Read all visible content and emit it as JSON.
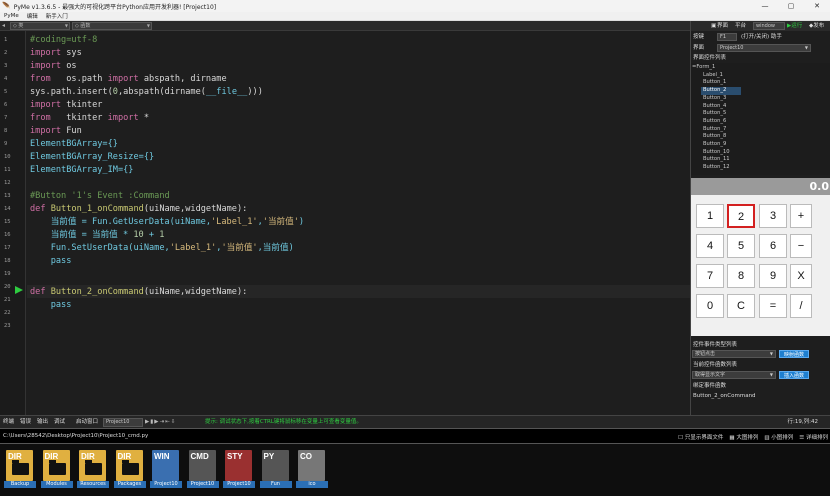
{
  "window": {
    "title": "PyMe v1.3.6.5 - 最强大的可视化跨平台Python应用开发利器! [Project10]",
    "controls": [
      "—",
      "▢",
      "✕"
    ]
  },
  "menu": [
    "PyMe",
    "编辑",
    "新手入门"
  ],
  "toolbar": {
    "class_combo": "◇ 类",
    "func_combo": "◇ 函数"
  },
  "lines": [
    "1",
    "2",
    "3",
    "4",
    "5",
    "6",
    "7",
    "8",
    "9",
    "10",
    "11",
    "12",
    "13",
    "14",
    "15",
    "16",
    "17",
    "18",
    "19",
    "20",
    "21",
    "22",
    "23"
  ],
  "code": {
    "l1": "#coding=utf-8",
    "l2a": "import",
    "l2b": " sys",
    "l3a": "import",
    "l3b": " os",
    "l4a": "from",
    "l4b": "   os.path ",
    "l4c": "import",
    "l4d": " abspath, dirname",
    "l5a": "sys.path.insert(",
    "l5b": "0",
    "l5c": ",abspath(dirname(",
    "l5d": "__file__",
    "l5e": ")))",
    "l6a": "import",
    "l6b": " tkinter",
    "l7a": "from",
    "l7b": "   tkinter ",
    "l7c": "import",
    "l7d": " *",
    "l8a": "import",
    "l8b": " Fun",
    "l9": "ElementBGArray={}",
    "l10": "ElementBGArray_Resize={}",
    "l11": "ElementBGArray_IM={}",
    "l13": "#Button '1's Event :Command",
    "l14a": "def ",
    "l14b": "Button_1_onCommand",
    "l14c": "(uiName,widgetName):",
    "l15a": "    当前值 = Fun.GetUserData(uiName,",
    "l15b": "'Label_1'",
    ",": "",
    "l15c": ",",
    "l15d": "'当前值'",
    "l15e": ")",
    "l16a": "    当前值 = 当前值 * ",
    "l16b": "10",
    "l16c": " + ",
    "l16d": "1",
    "l17a": "    Fun.SetUserData(uiName,",
    "l17b": "'Label_1'",
    "l17c": ",",
    "l17d": "'当前值'",
    "l17e": ",当前值)",
    "l18": "    pass",
    "l20a": "def ",
    "l20b": "Button_2_onCommand",
    "l20c": "(uiName,widgetName):",
    "l21": "    pass"
  },
  "right_panel": {
    "top_tabs": [
      "界面",
      "平台",
      "window",
      "▶运行",
      "◆发布"
    ],
    "hotkey_label": "按键",
    "hotkey_value": "F1",
    "hotkey_desc": "(打开/关闭) 助手",
    "ui_label": "界面",
    "ui_value": "Project10",
    "tree_title": "界面控件列表",
    "tree_root": "=Form_1",
    "tree_items": [
      "Label_1",
      "Button_1",
      "Button_2",
      "Button_3",
      "Button_4",
      "Button_5",
      "Button_6",
      "Button_7",
      "Button_8",
      "Button_9",
      "Button_10",
      "Button_11",
      "Button_12"
    ],
    "selected_index": 2,
    "calc_display": "0.0",
    "calc_keys": [
      "1",
      "2",
      "3",
      "+",
      "4",
      "5",
      "6",
      "−",
      "7",
      "8",
      "9",
      "X",
      "0",
      "C",
      "=",
      "/"
    ],
    "event_title": "控件事件类型列表",
    "event_value": "按钮点击",
    "event_btn": "映射函数",
    "func_title": "当前控件函数列表",
    "func_value": "取得显示文字",
    "func_btn": "插入函数",
    "bind_title": "绑定事件函数",
    "bind_value": "Button_2_onCommand"
  },
  "statusbar": {
    "tabs": [
      "终端",
      "错误",
      "输出",
      "调试"
    ],
    "start_label": "启动窗口",
    "start_value": "Project10",
    "hint": "提示: 调试状态下,按着CTRL键将鼠标移在变量上可查看变量值。",
    "position": "行:19,列:42"
  },
  "terminal": {
    "path": "C:\\Users\\28542\\Desktop\\Project10\\Project10_cmd.py",
    "options": [
      "只显示界面文件",
      "大图排列",
      "小图排列",
      "详细排列"
    ]
  },
  "files": [
    {
      "tag": "DIR",
      "name": "Backup",
      "color": "#e0b040"
    },
    {
      "tag": "DIR",
      "name": "Modules",
      "color": "#e0b040"
    },
    {
      "tag": "DIR",
      "name": "Resources",
      "color": "#e0b040"
    },
    {
      "tag": "DIR",
      "name": "Packages",
      "color": "#e0b040"
    },
    {
      "tag": "WIN",
      "name": "Project10",
      "color": "#3a6fb0"
    },
    {
      "tag": "CMD",
      "name": "Project10",
      "color": "#555555"
    },
    {
      "tag": "STY",
      "name": "Project10",
      "color": "#9a3030"
    },
    {
      "tag": "PY",
      "name": "Fun",
      "color": "#555555"
    },
    {
      "tag": "CO",
      "name": "ico",
      "color": "#777777"
    }
  ]
}
